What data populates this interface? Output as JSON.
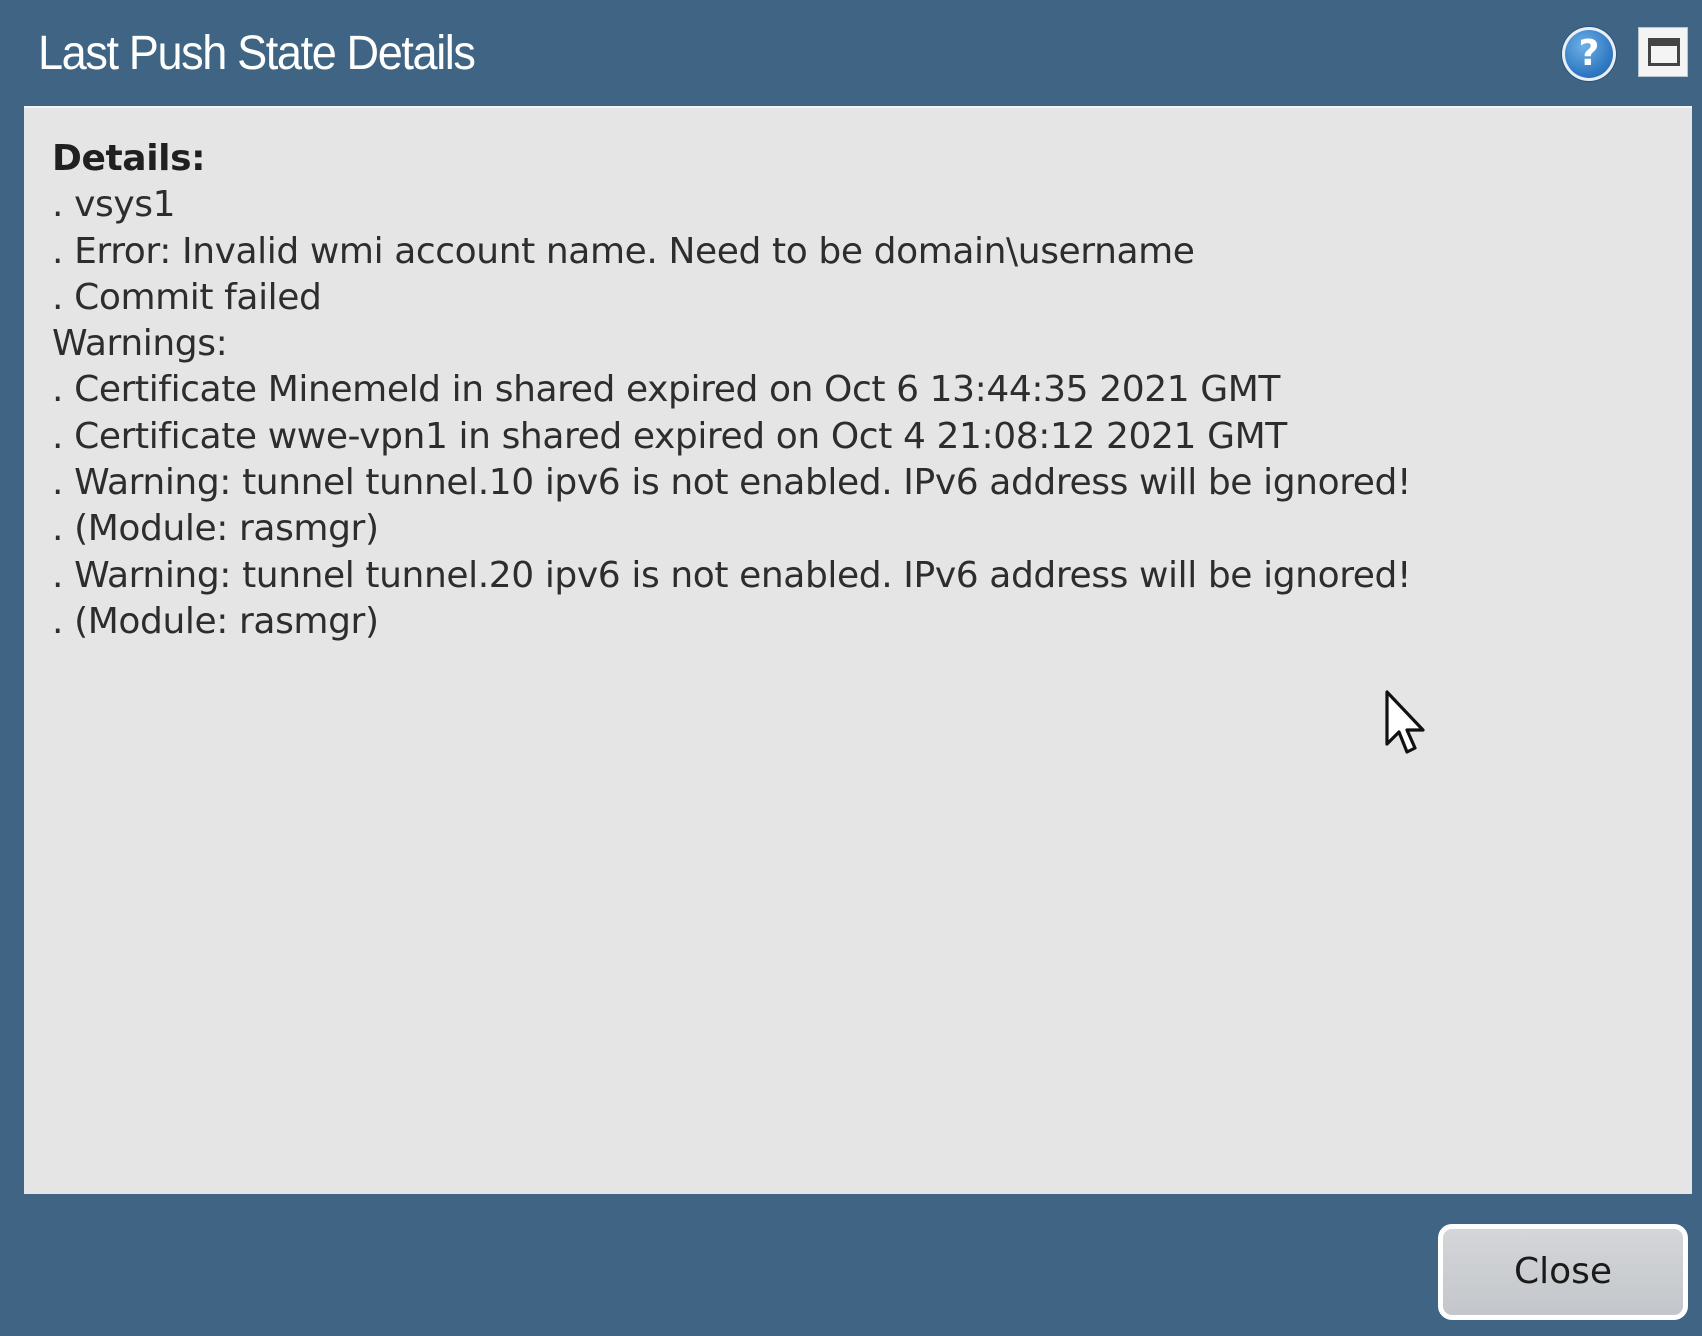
{
  "dialog": {
    "title": "Last Push State Details",
    "help_glyph": "?",
    "close_label": "Close"
  },
  "details": {
    "heading": "Details:",
    "lines": [
      ". vsys1",
      ". Error: Invalid wmi account name. Need to be domain\\username",
      ". Commit failed",
      "Warnings:",
      ". Certificate Minemeld in shared expired on Oct 6 13:44:35 2021 GMT",
      ". Certificate wwe-vpn1 in shared expired on Oct 4 21:08:12 2021 GMT",
      ". Warning: tunnel tunnel.10 ipv6 is not enabled. IPv6 address will be ignored!",
      ". (Module: rasmgr)",
      ". Warning: tunnel tunnel.20 ipv6 is not enabled. IPv6 address will be ignored!",
      ". (Module: rasmgr)"
    ]
  },
  "icons": {
    "help": "help-icon",
    "maximize": "maximize-icon",
    "cursor": "mouse-pointer-icon"
  },
  "colors": {
    "frame": "#3f6484",
    "content_bg": "#e5e5e5",
    "text": "#2d2d2d",
    "button_bg": "#c9cbce"
  }
}
